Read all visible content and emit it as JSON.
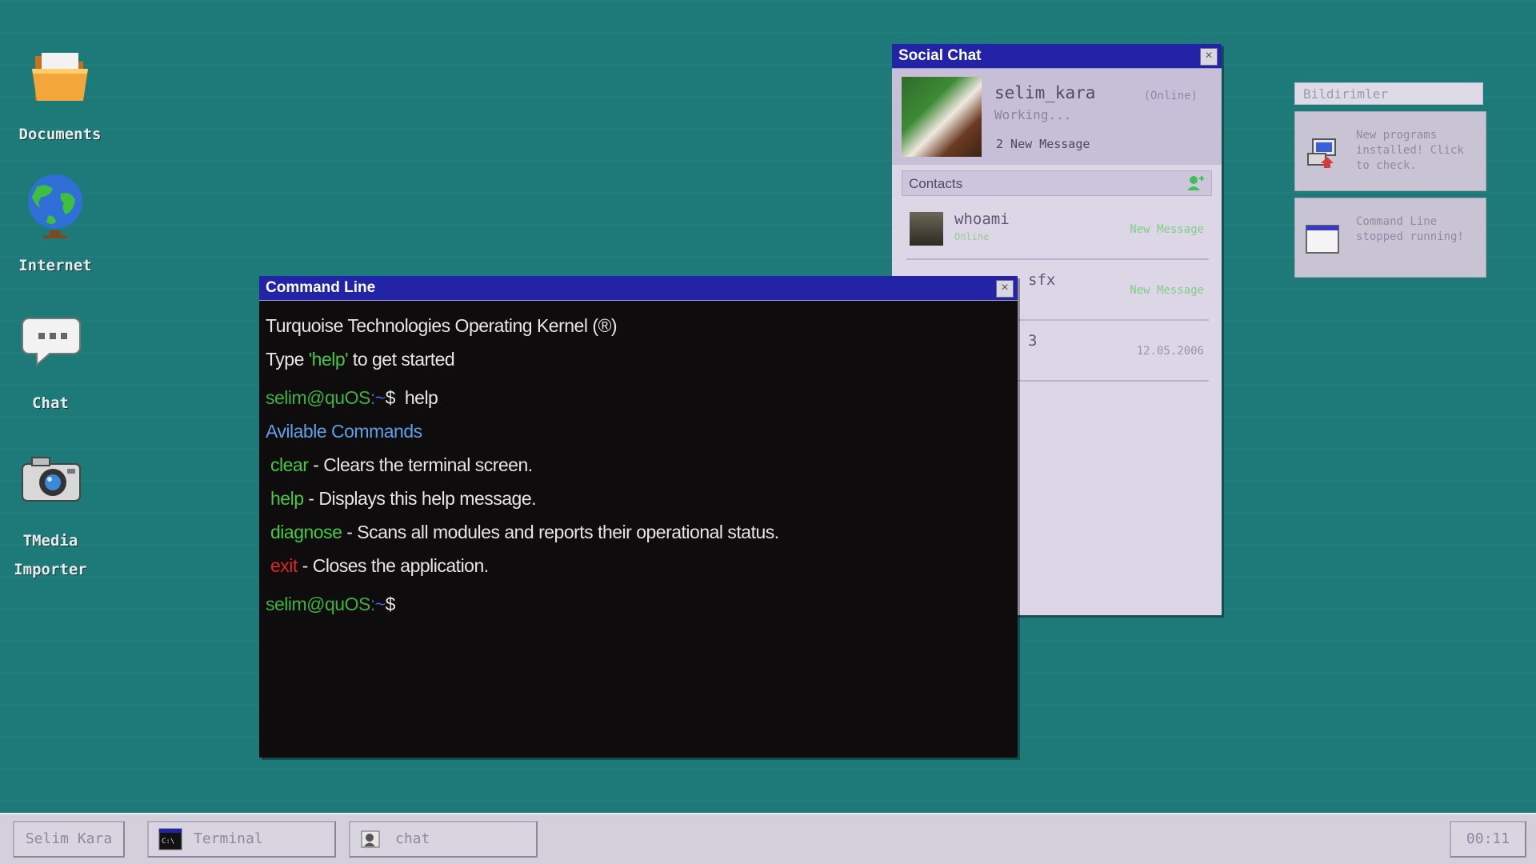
{
  "desktop": {
    "icons": [
      {
        "label": "Documents"
      },
      {
        "label": "Internet"
      },
      {
        "label": "Chat"
      },
      {
        "label": "TMedia Importer"
      }
    ]
  },
  "social_chat": {
    "title": "Social Chat",
    "profile": {
      "username": "selim_kara",
      "presence": "(Online)",
      "status": "Working...",
      "message_count": "2 New Message"
    },
    "contacts_label": "Contacts",
    "contacts": [
      {
        "name": "whoami",
        "sub": "Online",
        "right": "New Message"
      },
      {
        "name": "sfx",
        "sub": "",
        "right": "New Message"
      },
      {
        "name": "3",
        "sub": "",
        "right": "12.05.2006"
      }
    ]
  },
  "notifications": {
    "title": "Bildirimler",
    "items": [
      {
        "text": "New programs installed! Click to check."
      },
      {
        "text": "Command Line stopped running!"
      }
    ]
  },
  "terminal": {
    "title": "Command Line",
    "banner": "Turquoise Technologies Operating Kernel (®)",
    "hint_pre": "Type ",
    "hint_cmd": "'help'",
    "hint_post": " to get started",
    "prompt_user": "selim@quOS",
    "prompt_path": ":~",
    "prompt_symbol": "$",
    "entered_command": "help",
    "commands_heading": "Avilable Commands",
    "commands": [
      {
        "name": "clear",
        "desc": " - Clears the terminal screen."
      },
      {
        "name": "help",
        "desc": " - Displays this help message."
      },
      {
        "name": "diagnose",
        "desc": " - Scans all modules and reports their operational status."
      },
      {
        "name": "exit",
        "desc": " - Closes the application."
      }
    ]
  },
  "taskbar": {
    "user_button": "Selim Kara",
    "items": [
      {
        "label": "Terminal"
      },
      {
        "label": "chat"
      }
    ],
    "clock": "00:11"
  },
  "colors": {
    "desktop": "#1d7a78",
    "titlebar": "#2323a8",
    "terminal_bg": "#0e0c0c",
    "command_green": "#45c943",
    "exit_red": "#e02525"
  }
}
